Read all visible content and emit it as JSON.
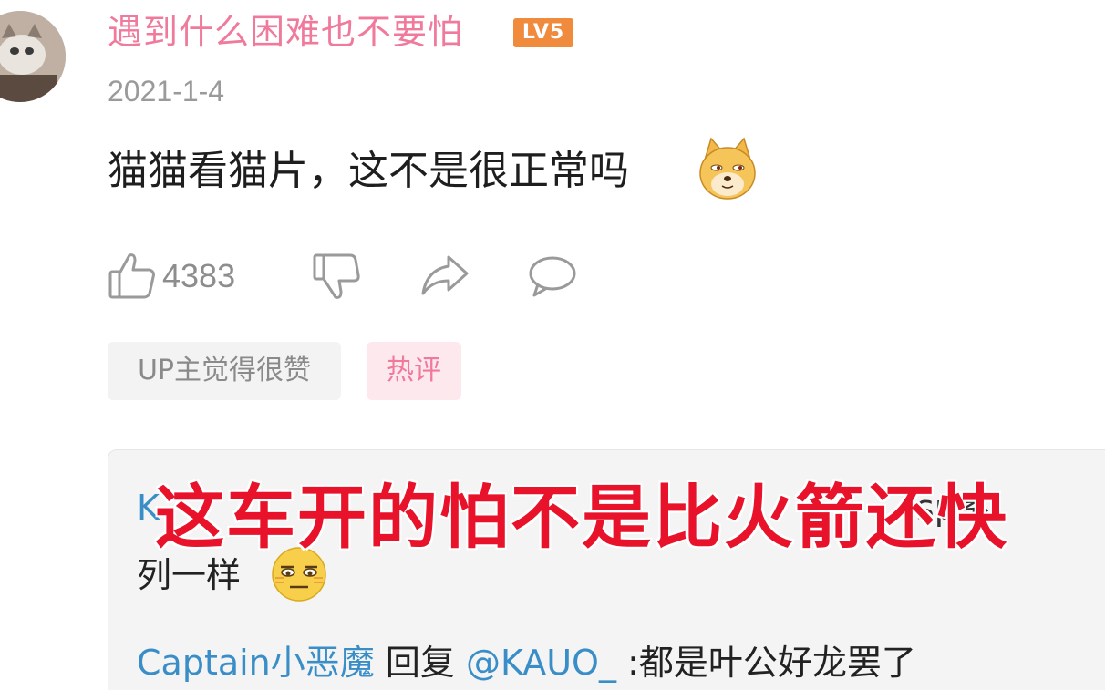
{
  "comment": {
    "username": "遇到什么困难也不要怕",
    "level_badge": "LV5",
    "date": "2021-1-4",
    "text": "猫猫看猫片，这不是很正常吗",
    "emoji": "doge-emoji",
    "like_count": "4383",
    "tags": {
      "up_liked": "UP主觉得很赞",
      "hot": "热评"
    }
  },
  "replies": {
    "first": {
      "user": "K",
      "text_tail": "sp系",
      "continuation": "列一样",
      "emoji": "meh-emoji"
    },
    "second": {
      "user": "Captain小恶魔",
      "reply_word": "回复",
      "mention": "@KAUO_",
      "text": ":都是叶公好龙罢了"
    }
  },
  "overlay": {
    "caption": "这车开的怕不是比火箭还快"
  },
  "colors": {
    "username": "#f07a9c",
    "level_badge": "#f08a3c",
    "link": "#3a8ec7",
    "caption": "#e8132a"
  }
}
